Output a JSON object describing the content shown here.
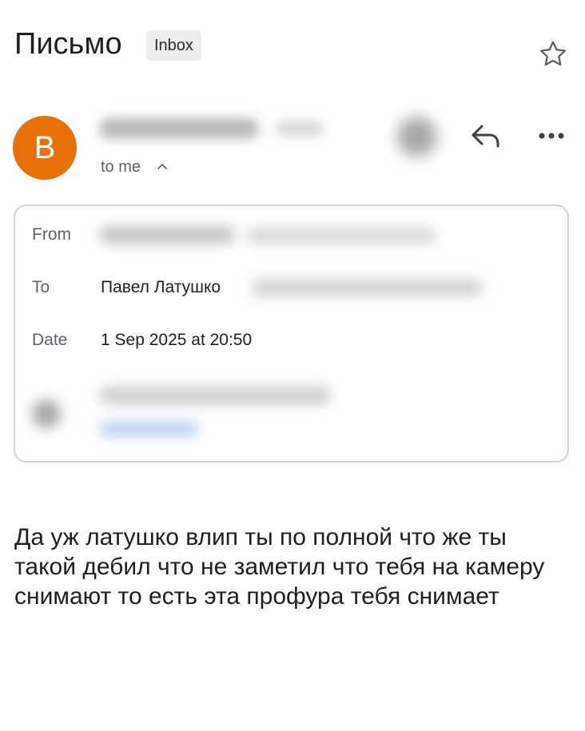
{
  "header": {
    "subject": "Письмо",
    "label": "Inbox"
  },
  "sender": {
    "avatar_initial": "B",
    "avatar_color": "#e8710a",
    "recipient_summary": "to me"
  },
  "details": {
    "from_label": "From",
    "to_label": "To",
    "to_name": "Павел Латушко",
    "date_label": "Date",
    "date_value": "1 Sep 2025 at 20:50"
  },
  "body": {
    "text": "Да уж латушко влип ты по полной что же ты такой дебил что не заметил что тебя на камеру снимают то есть эта профура тебя снимает"
  },
  "icons": {
    "star": "star-outline-icon",
    "reply": "reply-icon",
    "more": "more-horizontal-icon",
    "chevron": "chevron-up-icon"
  }
}
